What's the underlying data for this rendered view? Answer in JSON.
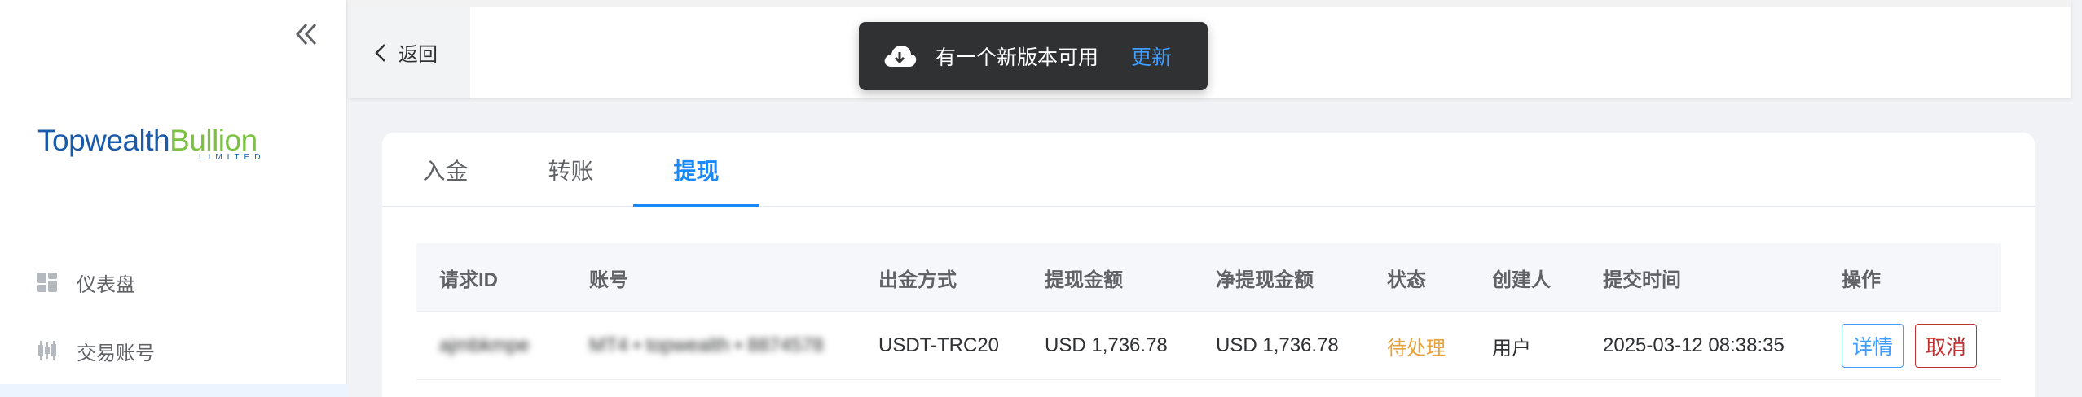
{
  "sidebar": {
    "logo": {
      "part1": "Topwealth",
      "part2": "Bullion",
      "sub": "LIMITED"
    },
    "items": [
      {
        "label": "仪表盘",
        "icon": "dashboard-icon"
      },
      {
        "label": "交易账号",
        "icon": "candlestick-icon"
      }
    ]
  },
  "topbar": {
    "back_label": "返回"
  },
  "toast": {
    "message": "有一个新版本可用",
    "action": "更新",
    "icon": "cloud-download-icon"
  },
  "tabs": [
    {
      "label": "入金"
    },
    {
      "label": "转账"
    },
    {
      "label": "提现",
      "active": true
    }
  ],
  "table": {
    "headers": [
      "请求ID",
      "账号",
      "出金方式",
      "提现金额",
      "净提现金额",
      "状态",
      "创建人",
      "提交时间",
      "操作"
    ],
    "rows": [
      {
        "id": "ajmbkmpe",
        "account": "MT4 • topwealth • 8874578",
        "method": "USDT-TRC20",
        "amount": "USD 1,736.78",
        "net_amount": "USD 1,736.78",
        "status": "待处理",
        "creator": "用户",
        "submitted": "2025-03-12 08:38:35",
        "actions": {
          "detail": "详情",
          "cancel": "取消"
        }
      }
    ]
  },
  "colors": {
    "primary": "#1989fa",
    "pending": "#e6a23c",
    "danger": "#c03030",
    "toast_bg": "#303133"
  }
}
